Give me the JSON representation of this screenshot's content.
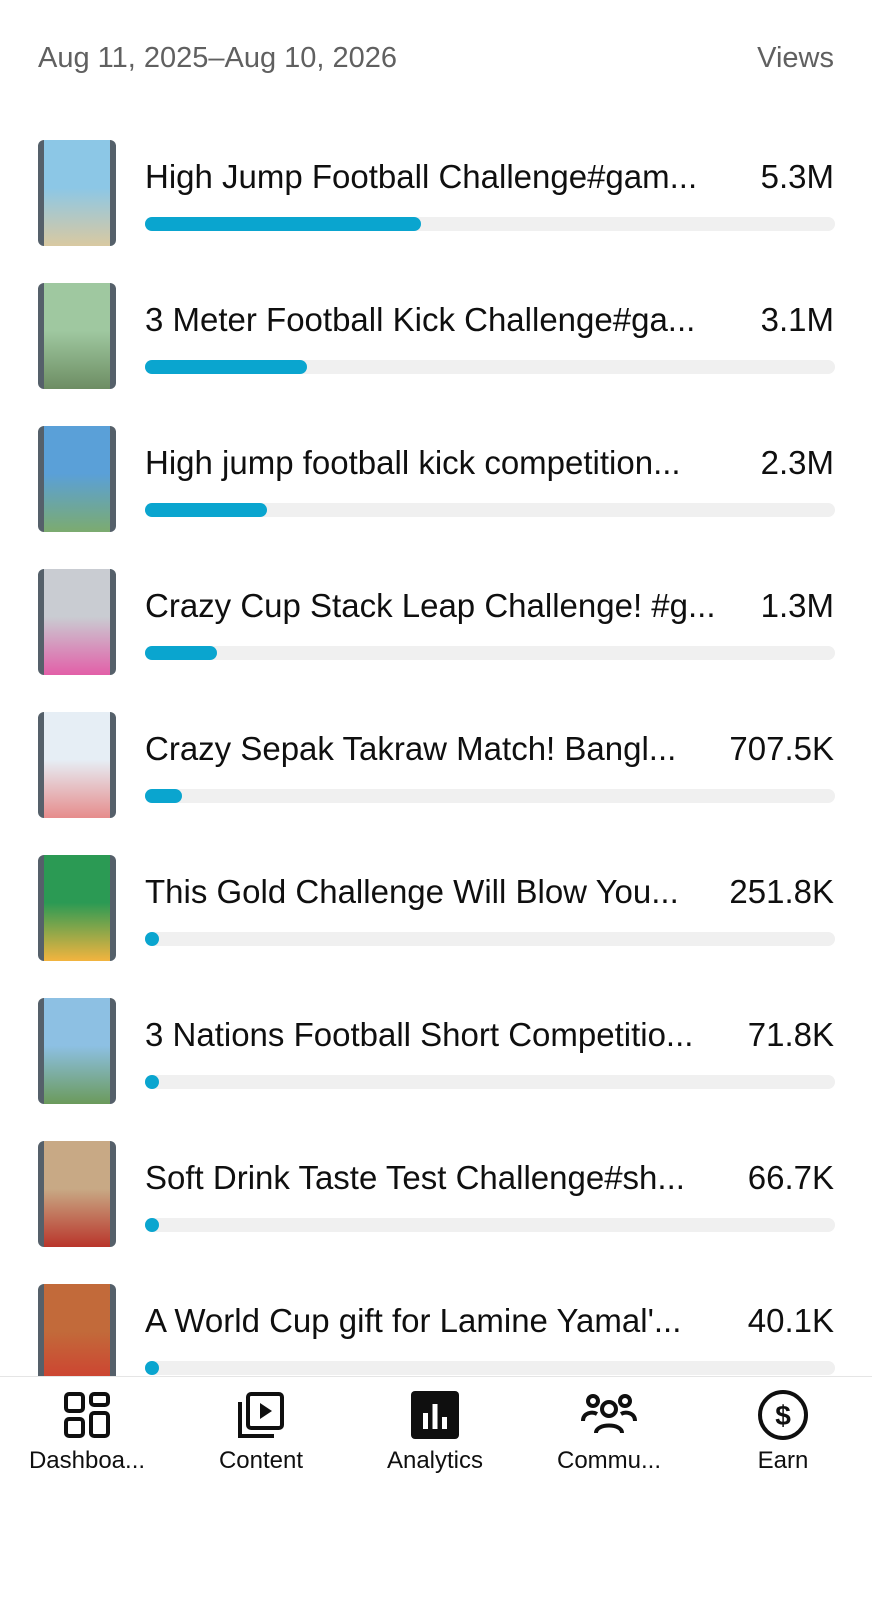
{
  "header": {
    "date_range": "Aug 11, 2025–Aug 10, 2026",
    "metric": "Views"
  },
  "videos": [
    {
      "title": "High Jump Football Challenge#gam...",
      "views": "5.3M",
      "fill": 0.4,
      "thumb_colors": [
        "#8cc7e6",
        "#d9c9a1"
      ]
    },
    {
      "title": "3 Meter Football Kick Challenge#ga...",
      "views": "3.1M",
      "fill": 0.235,
      "thumb_colors": [
        "#9fc8a0",
        "#6d8d63"
      ]
    },
    {
      "title": "High jump football kick competition...",
      "views": "2.3M",
      "fill": 0.177,
      "thumb_colors": [
        "#5aa0d8",
        "#7cab6f"
      ]
    },
    {
      "title": "Crazy Cup Stack Leap Challenge! #g...",
      "views": "1.3M",
      "fill": 0.104,
      "thumb_colors": [
        "#c9ccd2",
        "#e25fa8"
      ]
    },
    {
      "title": "Crazy Sepak Takraw Match! Bangl...",
      "views": "707.5K",
      "fill": 0.053,
      "thumb_colors": [
        "#e6eef5",
        "#e68c8c"
      ]
    },
    {
      "title": "This Gold Challenge Will Blow You...",
      "views": "251.8K",
      "fill": 0.02,
      "thumb_colors": [
        "#2b9a54",
        "#f3b43f"
      ]
    },
    {
      "title": "3 Nations Football Short Competitio...",
      "views": "71.8K",
      "fill": 0.02,
      "thumb_colors": [
        "#8dc0e3",
        "#6b9a5b"
      ]
    },
    {
      "title": "Soft Drink Taste Test Challenge#sh...",
      "views": "66.7K",
      "fill": 0.02,
      "thumb_colors": [
        "#c8a985",
        "#b9352b"
      ]
    },
    {
      "title": "A World Cup gift for Lamine Yamal'...",
      "views": "40.1K",
      "fill": 0.02,
      "thumb_colors": [
        "#c26a3a",
        "#d03a2f"
      ]
    }
  ],
  "nav": [
    {
      "label": "Dashboa...",
      "icon": "dashboard-icon"
    },
    {
      "label": "Content",
      "icon": "content-icon"
    },
    {
      "label": "Analytics",
      "icon": "analytics-icon",
      "active": true
    },
    {
      "label": "Commu...",
      "icon": "community-icon"
    },
    {
      "label": "Earn",
      "icon": "earn-icon"
    }
  ],
  "colors": {
    "accent": "#0aa5cf",
    "track": "#f0f0f0",
    "secondary_text": "#606060"
  }
}
